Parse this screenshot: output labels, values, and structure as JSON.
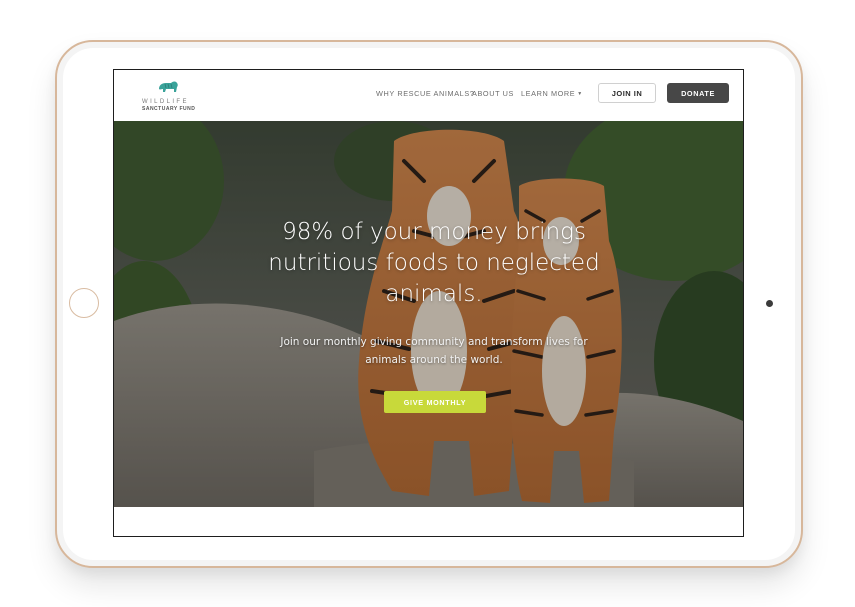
{
  "brand": {
    "logo_line1": "WILDLIFE",
    "logo_line2": "SANCTUARY FUND",
    "logo_icon": "tiger-icon",
    "logo_color": "#3aa39a"
  },
  "nav": {
    "links": [
      {
        "label": "WHY RESCUE ANIMALS?"
      },
      {
        "label": "ABOUT US"
      },
      {
        "label": "LEARN MORE"
      }
    ],
    "join_label": "JOIN IN",
    "donate_label": "DONATE"
  },
  "hero": {
    "title": "98% of your money brings nutritious foods to neglected animals.",
    "subtitle": "Join our monthly giving community and transform lives for animals around the world.",
    "cta_label": "GIVE MONTHLY",
    "cta_color": "#c8d93a"
  },
  "colors": {
    "device_frame": "#d7b79b",
    "donate_button": "#474747"
  }
}
